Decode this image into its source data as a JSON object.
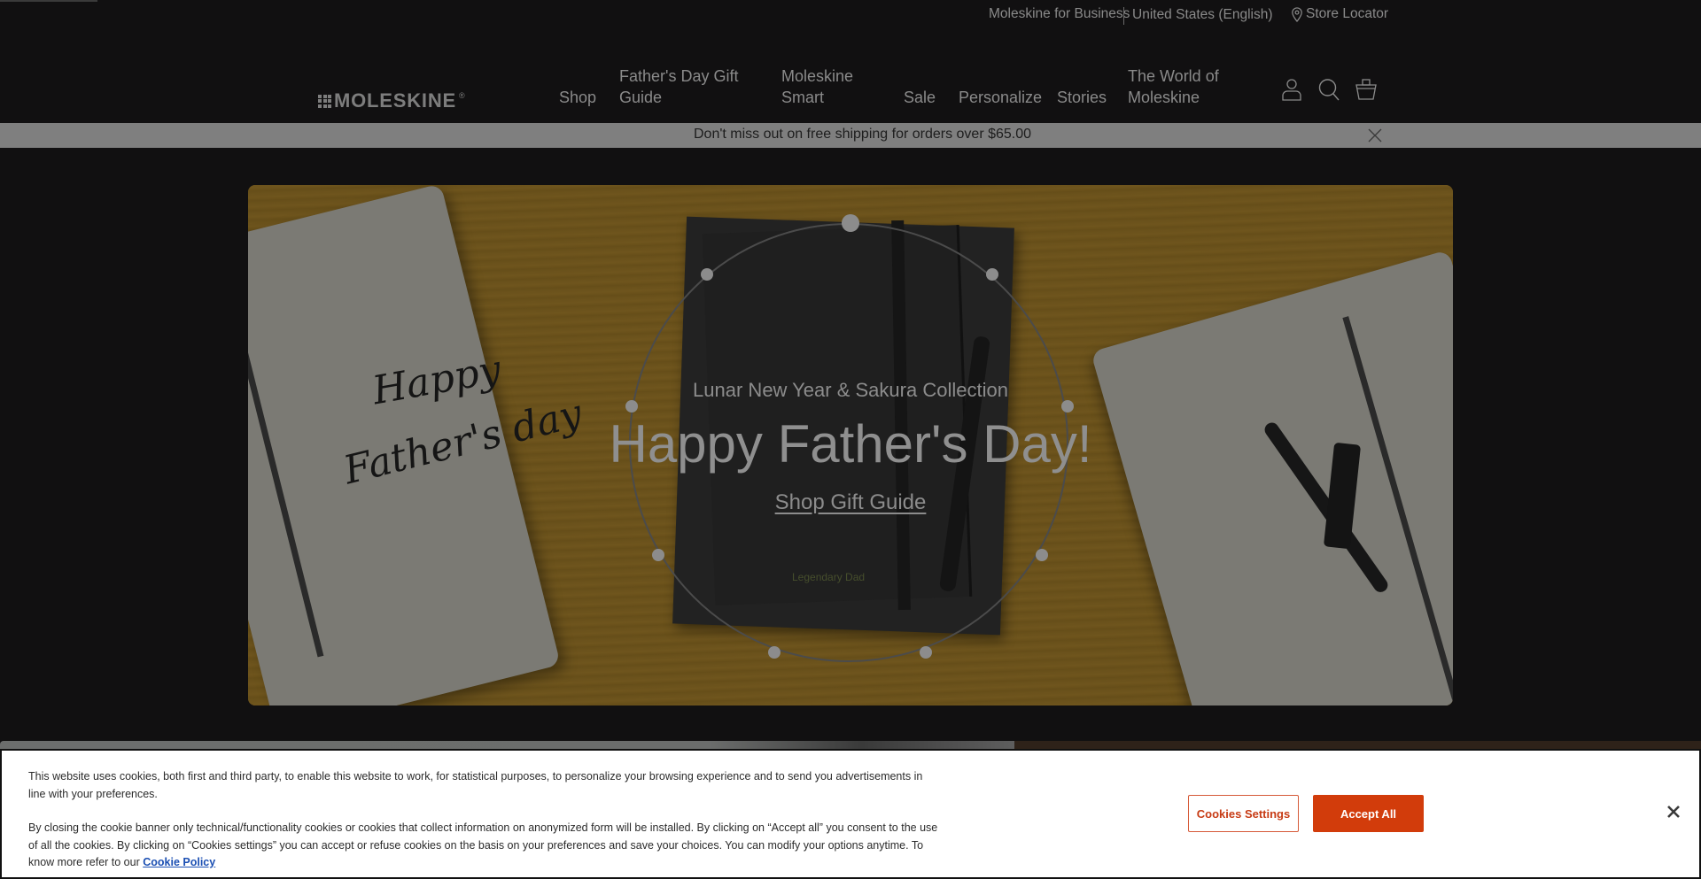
{
  "utility_bar": {
    "business_link": "Moleskine for Business",
    "country_selector": "United States (English)",
    "store_locator": "Store Locator"
  },
  "header": {
    "logo_text": "MOLESKINE",
    "logo_reg": "®",
    "nav": [
      {
        "label": "Shop"
      },
      {
        "label": "Father's Day Gift Guide",
        "line1": "Father's Day Gift",
        "line2": "Guide"
      },
      {
        "label": "Moleskine Smart",
        "line1": "Moleskine",
        "line2": "Smart"
      },
      {
        "label": "Sale"
      },
      {
        "label": "Personalize"
      },
      {
        "label": "Stories"
      },
      {
        "label": "The World of Moleskine",
        "line1": "The World of",
        "line2": "Moleskine"
      }
    ],
    "icons": [
      "account-icon",
      "search-icon",
      "cart-icon"
    ]
  },
  "promo_banner": {
    "text": "Don't miss out on free shipping for orders over $65.00"
  },
  "hero": {
    "image_handwriting_line1": "Happy",
    "image_handwriting_line2": "Father's day",
    "image_notebook_text": "Legendary Dad",
    "subtitle": "Lunar New Year & Sakura Collection",
    "title": "Happy Father's Day!",
    "cta": "Shop Gift Guide"
  },
  "cookie_banner": {
    "paragraph1": "This website uses cookies, both first and third party, to enable this website to work, for statistical purposes, to personalize your browsing experience and to send you advertisements in line with your preferences.",
    "paragraph2": "By closing the cookie banner only technical/functionality cookies or cookies that collect information on anonymized form will be installed. By clicking on “Accept all” you consent to the use of all the cookies. By clicking on “Cookies settings” you can accept or refuse cookies on the basis on your preferences and save your choices. You can modify your options anytime. To know more refer to our",
    "policy_link": "Cookie Policy",
    "settings_button": "Cookies Settings",
    "accept_button": "Accept All"
  },
  "colors": {
    "accent": "#d23c0b",
    "link": "#1b4fb3",
    "background": "#111011",
    "banner": "#7f7f7f"
  }
}
